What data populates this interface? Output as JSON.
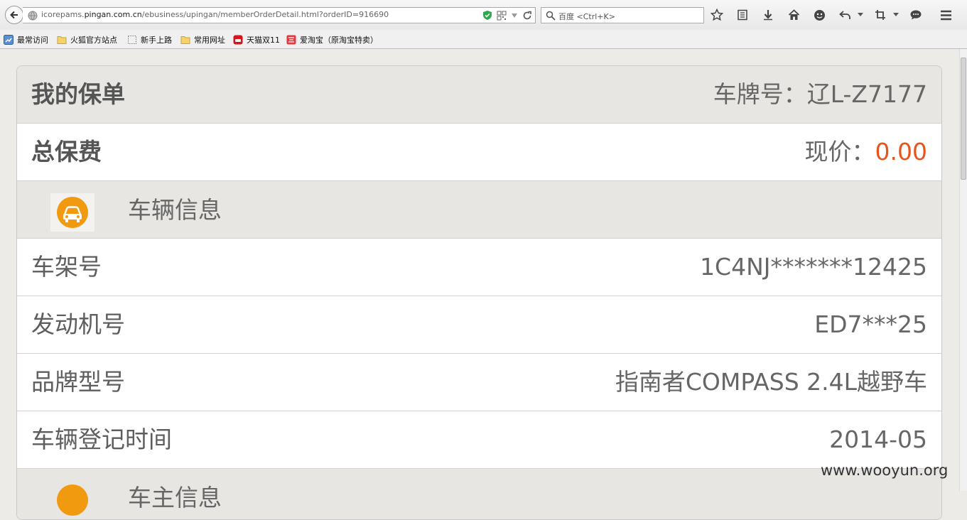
{
  "browser": {
    "url_prefix": "icorepams.",
    "url_host": "pingan.com.cn",
    "url_path": "/ebusiness/upingan/memberOrderDetail.html?orderID=916690",
    "search_placeholder": "百度 <Ctrl+K>"
  },
  "bookmarks": [
    {
      "label": "最常访问",
      "icon": "most-visited-icon"
    },
    {
      "label": "火狐官方站点",
      "icon": "folder-icon"
    },
    {
      "label": "新手上路",
      "icon": "dotted-page-icon"
    },
    {
      "label": "常用网址",
      "icon": "folder-icon"
    },
    {
      "label": "天猫双11",
      "icon": "tmall-icon"
    },
    {
      "label": "爱淘宝（原淘宝特卖）",
      "icon": "aitaobao-icon"
    }
  ],
  "page": {
    "header": {
      "title": "我的保单",
      "plate_label": "车牌号：辽L-Z7177"
    },
    "premium": {
      "label": "总保费",
      "price_label": "现价：",
      "price_value": "0.00"
    },
    "vehicle_section": {
      "title": "车辆信息",
      "icon": "car-icon"
    },
    "vehicle_rows": [
      {
        "label": "车架号",
        "value": "1C4NJ*******12425"
      },
      {
        "label": "发动机号",
        "value": "ED7***25"
      },
      {
        "label": "品牌型号",
        "value": "指南者COMPASS 2.4L越野车"
      },
      {
        "label": "车辆登记时间",
        "value": "2014-05"
      }
    ],
    "next_section": {
      "title": "车主信息"
    }
  },
  "watermark": "www.wooyun.org",
  "colors": {
    "accent_price": "#e8541b",
    "icon_orange": "#f29a0f"
  }
}
